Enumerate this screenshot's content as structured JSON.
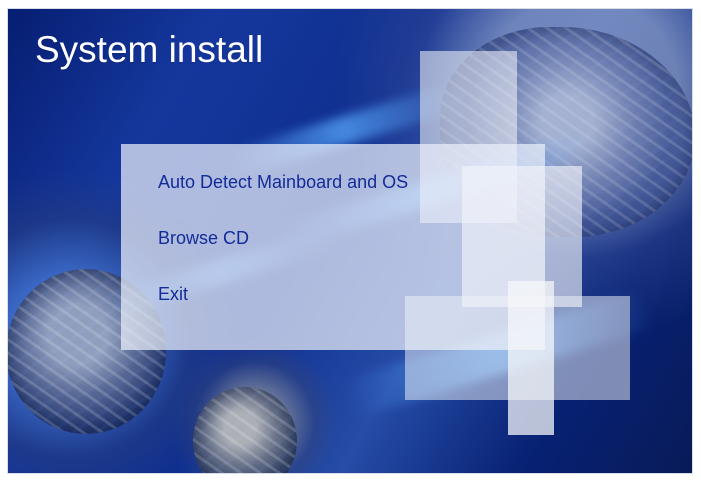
{
  "installer": {
    "title": "System install",
    "menu": [
      {
        "label": "Auto Detect Mainboard and OS"
      },
      {
        "label": "Browse CD"
      },
      {
        "label": "Exit"
      }
    ],
    "colors": {
      "menu_text": "#132c98",
      "title_text": "#ffffff",
      "background": "#15379d"
    }
  }
}
